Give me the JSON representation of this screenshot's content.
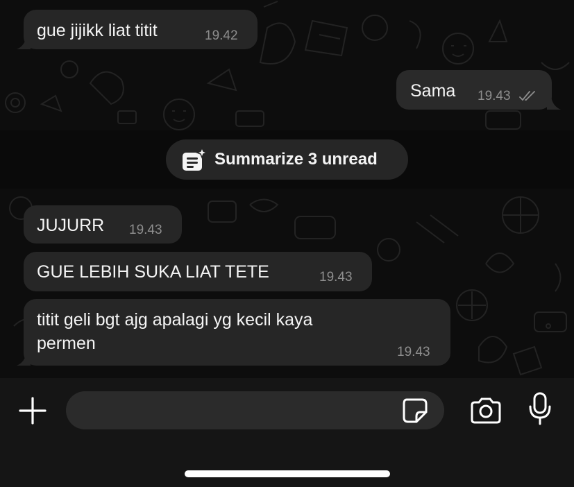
{
  "messages": [
    {
      "direction": "incoming",
      "text": "gue jijikk liat titit",
      "time": "19.42"
    },
    {
      "direction": "outgoing",
      "text": "Sama",
      "time": "19.43",
      "status": "read-double-check"
    },
    {
      "direction": "incoming",
      "text": "JUJURR",
      "time": "19.43"
    },
    {
      "direction": "incoming",
      "text": "GUE LEBIH SUKA LIAT TETE",
      "time": "19.43"
    },
    {
      "direction": "incoming",
      "text": "titit geli bgt ajg apalagi yg kecil kaya\npermen",
      "time": "19.43"
    }
  ],
  "summary": {
    "label": "Summarize 3 unread",
    "icon": "ai-summary-icon"
  },
  "composer": {
    "input_value": "",
    "icons": [
      "plus-icon",
      "sticker-icon",
      "camera-icon",
      "microphone-icon"
    ]
  },
  "colors": {
    "background": "#0d0d0d",
    "bubble": "#262626",
    "timestamp": "#8e8e8e",
    "composer": "#151515"
  }
}
